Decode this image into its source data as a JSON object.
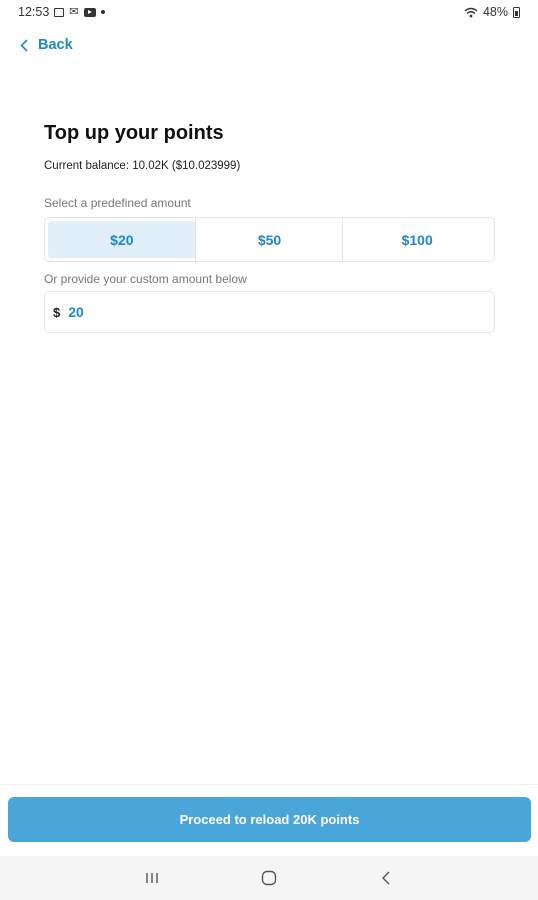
{
  "status_bar": {
    "time": "12:53",
    "battery": "48%"
  },
  "header": {
    "back_label": "Back"
  },
  "page": {
    "title": "Top up your points",
    "balance": "Current balance: 10.02K ($10.023999)"
  },
  "presets": {
    "label": "Select a predefined amount",
    "options": [
      "$20",
      "$50",
      "$100"
    ],
    "selected": "$20"
  },
  "custom": {
    "label": "Or provide your custom amount below",
    "currency": "$",
    "value": "20"
  },
  "action": {
    "proceed_label": "Proceed to reload 20K points"
  },
  "colors": {
    "accent": "#1e88c8",
    "button": "#4aa6d9",
    "selected_bg": "#e0eff9"
  }
}
